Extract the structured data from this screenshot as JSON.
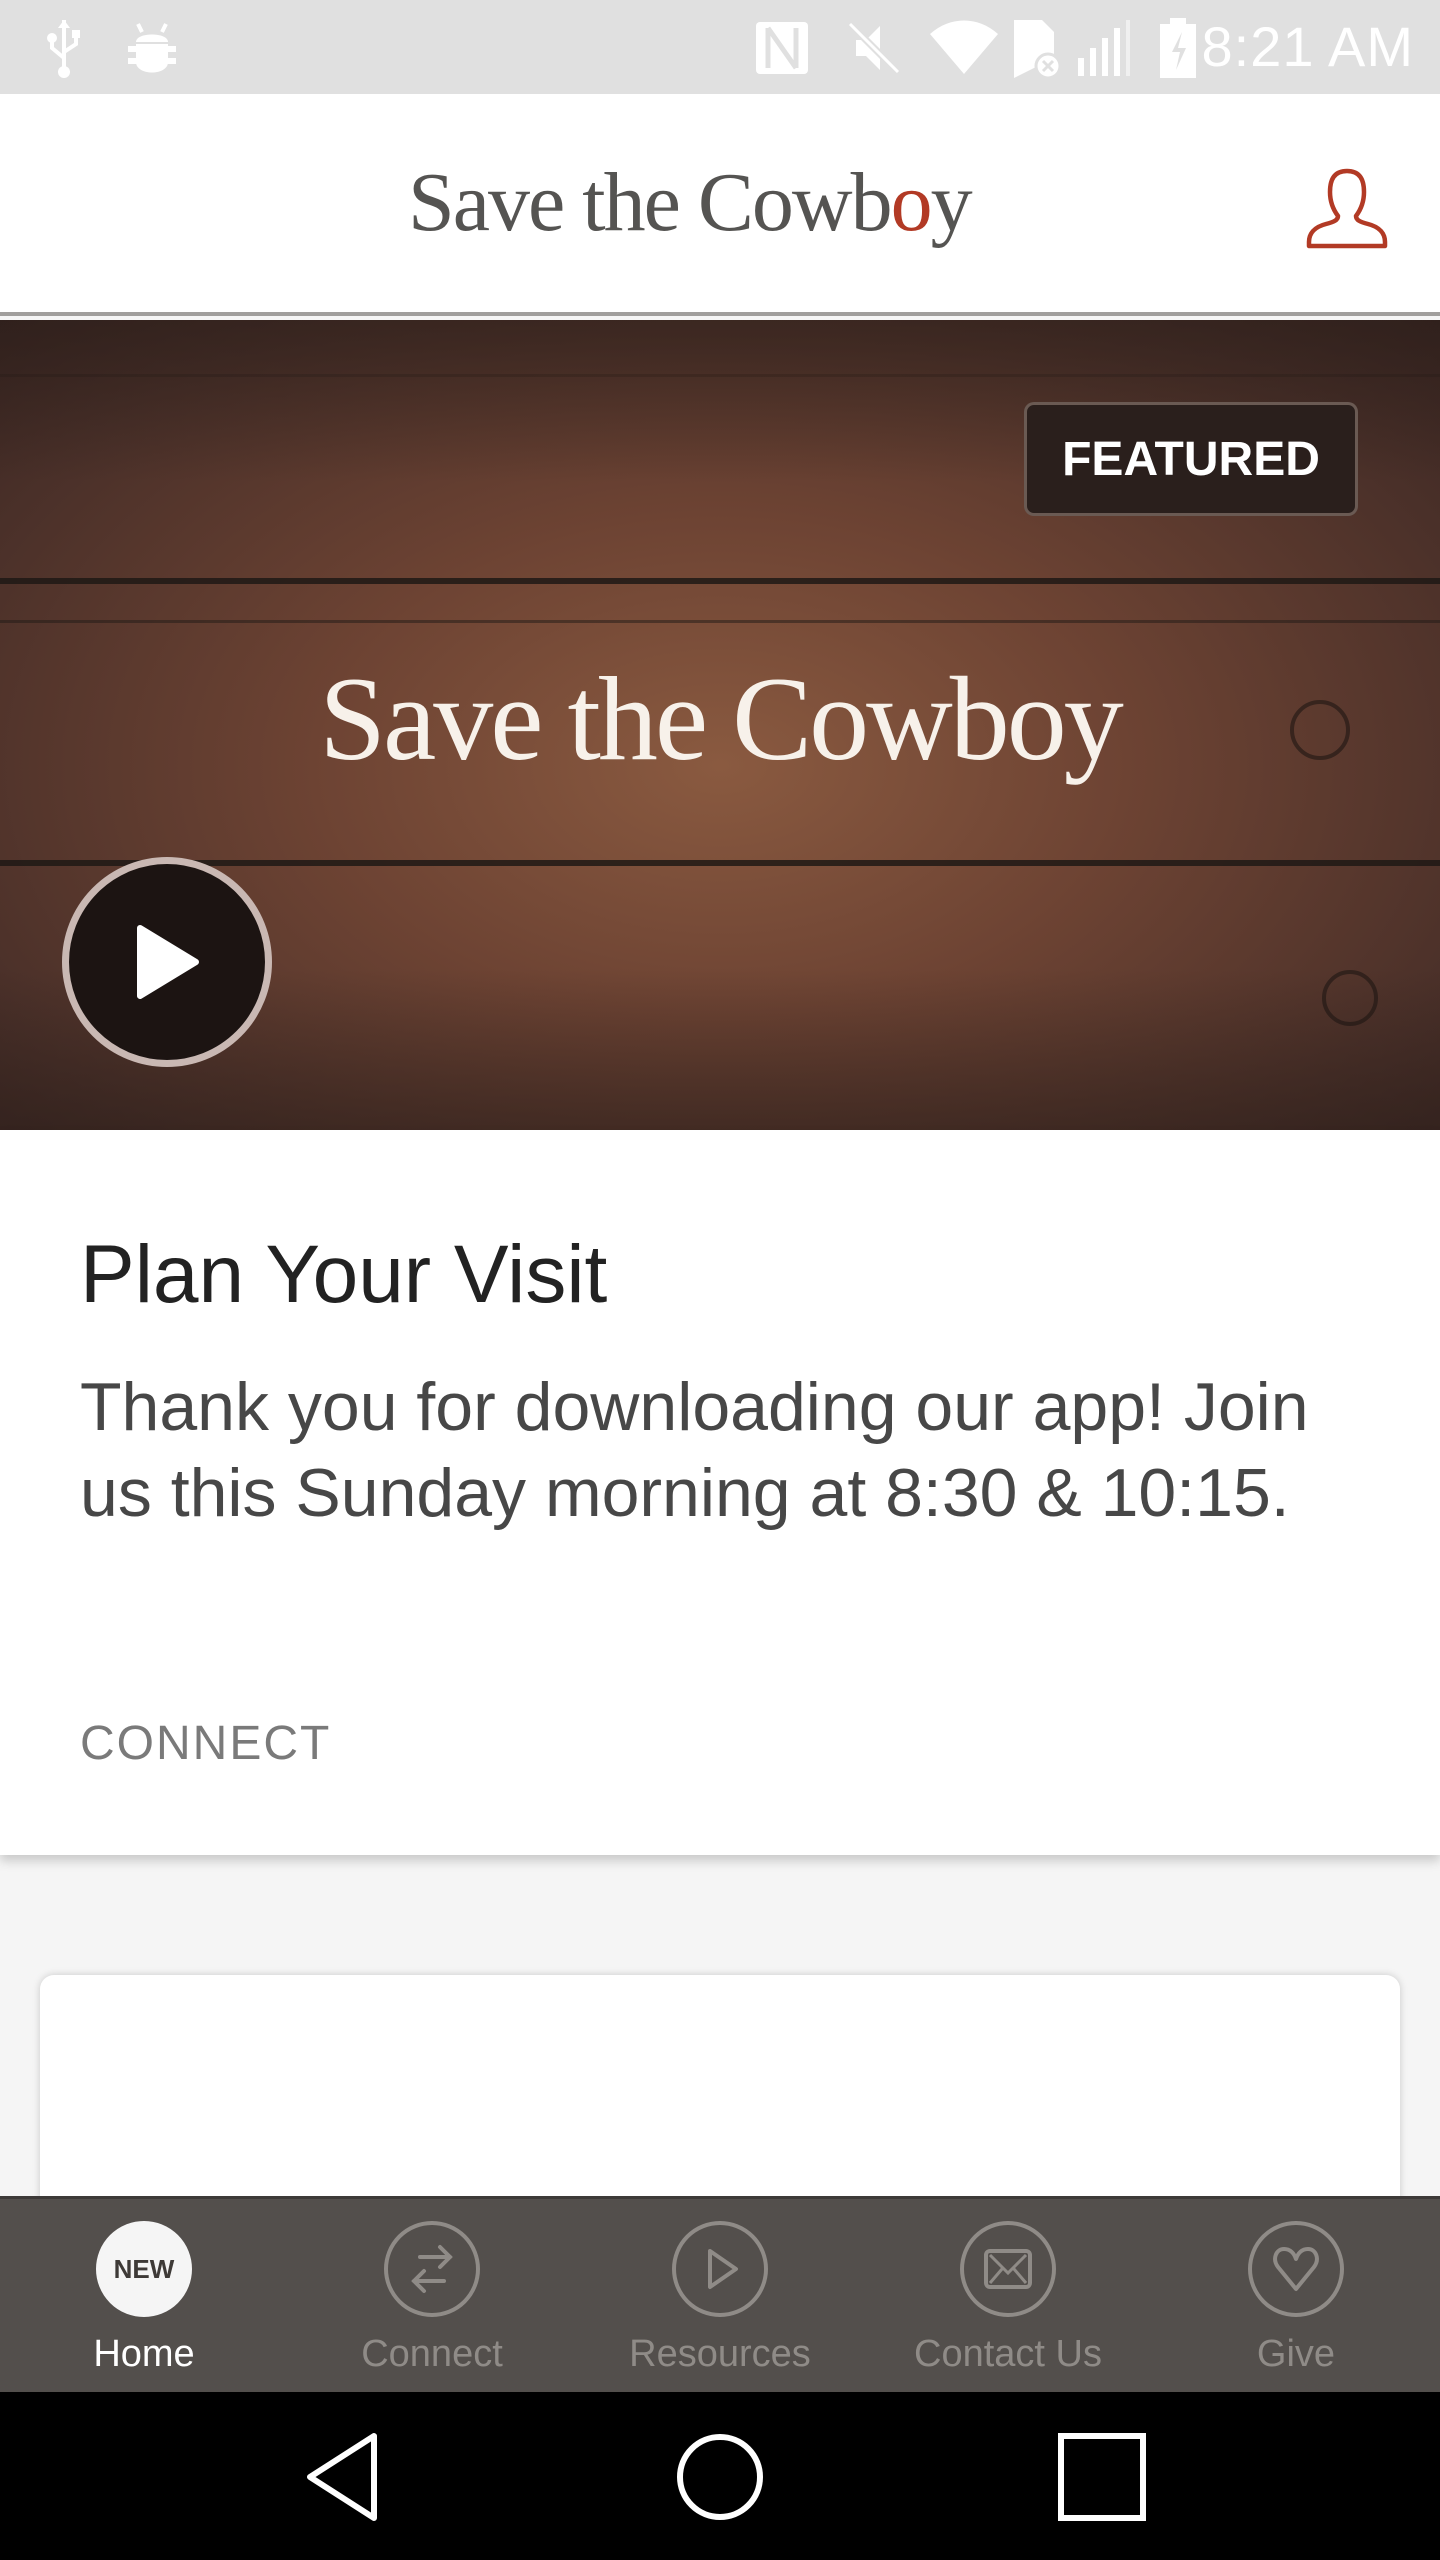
{
  "status_bar": {
    "time": "8:21 AM",
    "left_icons": [
      "usb-icon",
      "android-debug-icon"
    ],
    "right_icons": [
      "nfc-icon",
      "mute-icon",
      "wifi-icon",
      "no-sim-icon",
      "signal-icon",
      "battery-charging-icon"
    ]
  },
  "header": {
    "logo_text": "Save the Cowb",
    "logo_hat": "o",
    "logo_tail": "y",
    "profile_icon": "user-profile-icon",
    "accent_color": "#b23a25"
  },
  "hero": {
    "badge": "FEATURED",
    "title": "Save the Cowboy",
    "play_icon": "play-icon"
  },
  "featured_card": {
    "title": "Plan Your Visit",
    "body": "Thank you for downloading our app! Join us this Sunday morning at 8:30 & 10:15.",
    "link": "CONNECT"
  },
  "tab_bar": {
    "background": "#534f4c",
    "tabs": [
      {
        "label": "Home",
        "icon": "new-badge-icon",
        "badge": "NEW",
        "active": true
      },
      {
        "label": "Connect",
        "icon": "swap-arrows-icon",
        "active": false
      },
      {
        "label": "Resources",
        "icon": "play-icon",
        "active": false
      },
      {
        "label": "Contact Us",
        "icon": "mail-icon",
        "active": false
      },
      {
        "label": "Give",
        "icon": "heart-icon",
        "active": false
      }
    ]
  },
  "nav_bar": {
    "buttons": [
      "back",
      "home",
      "recents"
    ]
  }
}
